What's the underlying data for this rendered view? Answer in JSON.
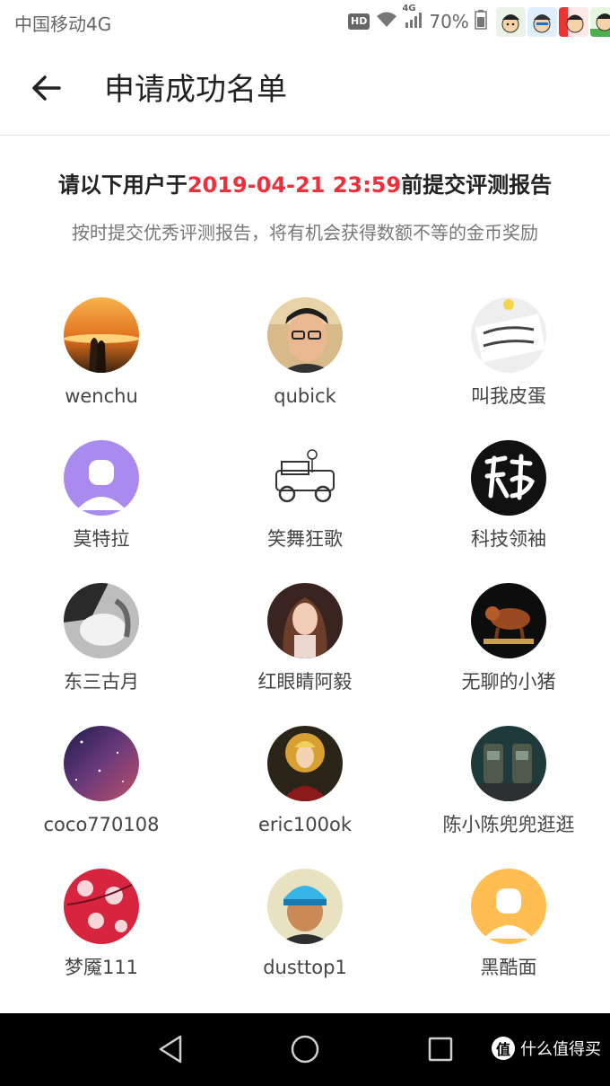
{
  "status_bar": {
    "carrier": "中国移动4G",
    "hd": "HD",
    "network": "4G",
    "battery": "70%"
  },
  "header": {
    "title": "申请成功名单"
  },
  "notice": {
    "prefix": "请以下用户于",
    "deadline": "2019-04-21 23:59",
    "suffix": "前提交评测报告",
    "subtitle": "按时提交优秀评测报告，将有机会获得数额不等的金币奖励"
  },
  "colors": {
    "accent": "#ef2f3a",
    "title_text": "#222222",
    "secondary_text": "#777777"
  },
  "users": [
    {
      "name": "wenchu"
    },
    {
      "name": "qubick"
    },
    {
      "name": "叫我皮蛋"
    },
    {
      "name": "莫特拉"
    },
    {
      "name": "笑舞狂歌"
    },
    {
      "name": "科技领袖"
    },
    {
      "name": "东三古月"
    },
    {
      "name": "红眼睛阿毅"
    },
    {
      "name": "无聊的小猪"
    },
    {
      "name": "coco770108"
    },
    {
      "name": "eric100ok"
    },
    {
      "name": "陈小陈兜兜逛逛"
    },
    {
      "name": "梦魇111"
    },
    {
      "name": "dusttop1"
    },
    {
      "name": "黑酷面"
    }
  ],
  "watermark": {
    "logo": "值",
    "text": "什么值得买"
  }
}
